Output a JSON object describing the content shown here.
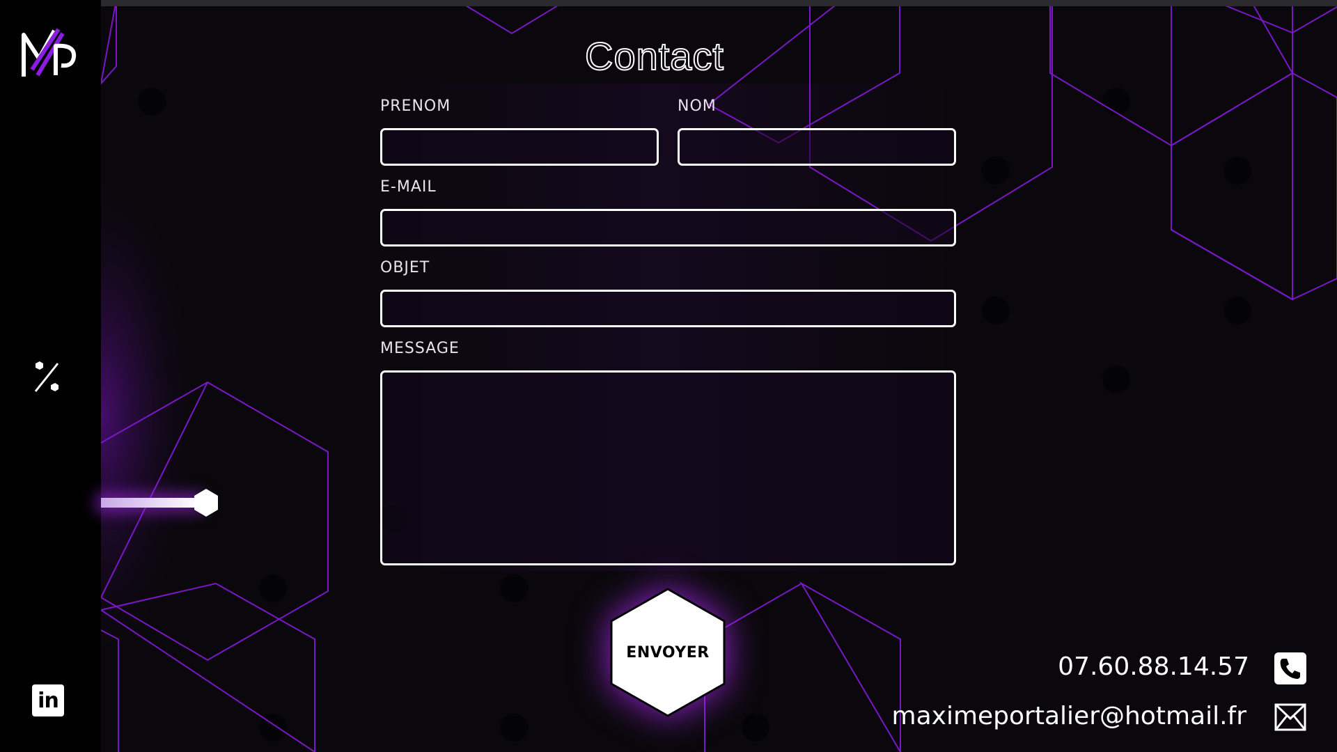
{
  "page": {
    "title": "Contact"
  },
  "form": {
    "first_name_label": "PRENOM",
    "first_name_value": "",
    "last_name_label": "NOM",
    "last_name_value": "",
    "email_label": "E-MAIL",
    "email_value": "",
    "subject_label": "OBJET",
    "subject_value": "",
    "message_label": "MESSAGE",
    "message_value": "",
    "submit_label": "ENVOYER"
  },
  "contact": {
    "phone": "07.60.88.14.57",
    "email": "maximeportalier@hotmail.fr"
  },
  "sidebar": {
    "logo_icon": "mp-logo",
    "nav_icon": "percent-icon",
    "social_icon": "linkedin-icon",
    "linkedin_text": "in"
  },
  "slider": {
    "level": 1.0
  },
  "colors": {
    "background": "#0a080c",
    "accent": "#8a1ee0",
    "hex_stroke": "#7a18c8",
    "sidebar": "#000000",
    "text": "#ffffff"
  }
}
